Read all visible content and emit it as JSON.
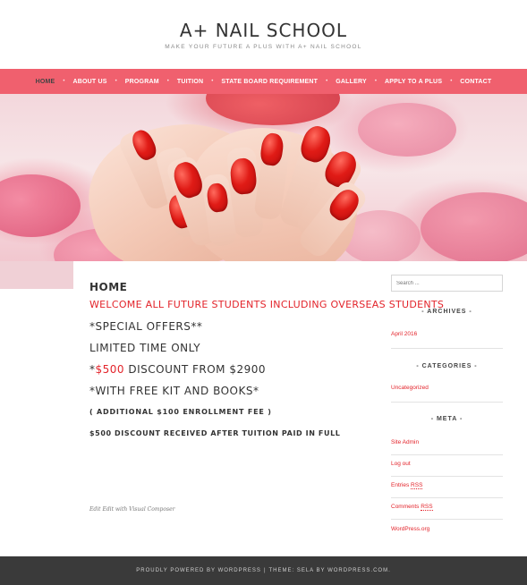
{
  "header": {
    "title": "A+ NAIL SCHOOL",
    "tagline": "MAKE YOUR FUTURE A PLUS WITH A+ NAIL SCHOOL"
  },
  "nav": {
    "items": [
      {
        "label": "HOME",
        "active": true
      },
      {
        "label": "ABOUT US"
      },
      {
        "label": "PROGRAM"
      },
      {
        "label": "TUITION"
      },
      {
        "label": "STATE BOARD REQUIREMENT"
      },
      {
        "label": "GALLERY"
      },
      {
        "label": "APPLY TO A PLUS"
      },
      {
        "label": "CONTACT"
      }
    ],
    "separator": "•"
  },
  "entry": {
    "title": "HOME",
    "welcome": "WELCOME ALL FUTURE STUDENTS INCLUDING OVERSEAS STUDENTS",
    "offers": "*SPECIAL OFFERS**",
    "limited": "LIMITED TIME ONLY",
    "discount_prefix": "*",
    "discount_amount": "$500",
    "discount_suffix": " DISCOUNT FROM $2900",
    "kit": "*WITH FREE KIT AND BOOKS*",
    "fee": "( ADDITIONAL $100 ENROLLMENT FEE )",
    "received": "$500 DISCOUNT RECEIVED AFTER TUITION PAID IN FULL",
    "edit_link": "Edit Edit with Visual Composer"
  },
  "sidebar": {
    "search_placeholder": "Search ...",
    "archives_title": "- ARCHIVES -",
    "archives": [
      "April 2016"
    ],
    "categories_title": "- CATEGORIES -",
    "categories": [
      "Uncategorized"
    ],
    "meta_title": "- META -",
    "meta": {
      "site_admin": "Site Admin",
      "log_out": "Log out",
      "entries_prefix": "Entries ",
      "entries_abbr": "RSS",
      "comments_prefix": "Comments ",
      "comments_abbr": "RSS",
      "wordpress": "WordPress.org"
    }
  },
  "footer": {
    "powered": "PROUDLY POWERED BY WORDPRESS",
    "separator": "|",
    "theme": "THEME: SELA BY WORDPRESS.COM."
  },
  "colors": {
    "accent": "#f0606e",
    "link_red": "#e3242b",
    "footer_bg": "#3a3a3a"
  }
}
